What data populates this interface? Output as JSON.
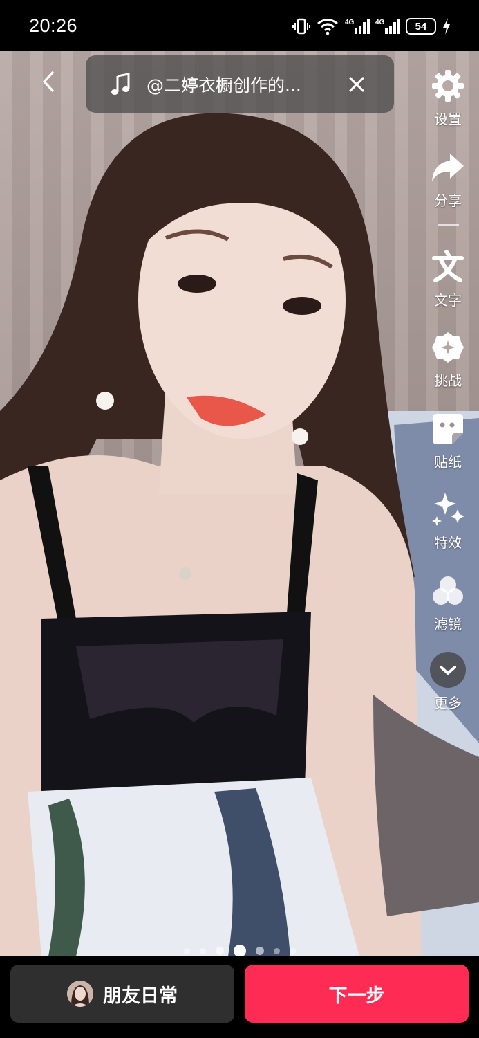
{
  "status_bar": {
    "time": "20:26",
    "battery": "54",
    "icons": [
      "vibrate-icon",
      "wifi-icon",
      "signal-4g-icon",
      "signal-4g-icon",
      "charging-icon"
    ]
  },
  "music": {
    "title": "@二婷衣橱创作的..."
  },
  "toolbar": {
    "items": [
      {
        "label": "设置",
        "icon": "gear-icon"
      },
      {
        "label": "分享",
        "icon": "share-icon"
      },
      {
        "label": "文字",
        "icon": "text-icon"
      },
      {
        "label": "挑战",
        "icon": "challenge-icon"
      },
      {
        "label": "贴纸",
        "icon": "sticker-icon"
      },
      {
        "label": "特效",
        "icon": "effects-icon"
      },
      {
        "label": "滤镜",
        "icon": "filter-icon"
      },
      {
        "label": "更多",
        "icon": "chevron-down-icon"
      }
    ]
  },
  "pager": {
    "count": 7,
    "active_index": 3
  },
  "bottom": {
    "daily_label": "朋友日常",
    "next_label": "下一步"
  },
  "colors": {
    "accent": "#fe2c55",
    "secondary_button": "#2f2f2f"
  }
}
